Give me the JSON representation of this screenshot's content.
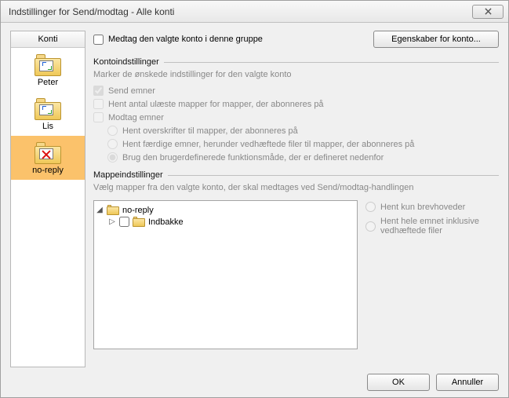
{
  "title": "Indstillinger for Send/modtag - Alle konti",
  "sidebar": {
    "header": "Konti",
    "accounts": [
      "Peter",
      "Lis",
      "no-reply"
    ],
    "selectedIndex": 2
  },
  "toprow": {
    "includeGroupLabel": "Medtag den valgte konto i denne gruppe",
    "accountPropsBtn": "Egenskaber for konto..."
  },
  "accountSettings": {
    "groupTitle": "Kontoindstillinger",
    "hint": "Marker de ønskede indstillinger for den valgte konto",
    "sendItems": "Send emner",
    "getUnread": "Hent antal ulæste mapper for mapper, der abonneres på",
    "receiveItems": "Modtag emner",
    "radios": [
      "Hent overskrifter til mapper, der abonneres på",
      "Hent færdige emner, herunder vedhæftede filer til mapper, der abonneres på",
      "Brug den brugerdefinerede funktionsmåde, der er defineret nedenfor"
    ]
  },
  "folderSettings": {
    "groupTitle": "Mappeindstillinger",
    "hint": "Vælg mapper fra den valgte konto, der skal medtages ved Send/modtag-handlingen",
    "tree": {
      "root": "no-reply",
      "child": "Indbakke"
    },
    "options": [
      "Hent kun brevhoveder",
      "Hent hele emnet inklusive vedhæftede filer"
    ]
  },
  "footer": {
    "ok": "OK",
    "cancel": "Annuller"
  }
}
